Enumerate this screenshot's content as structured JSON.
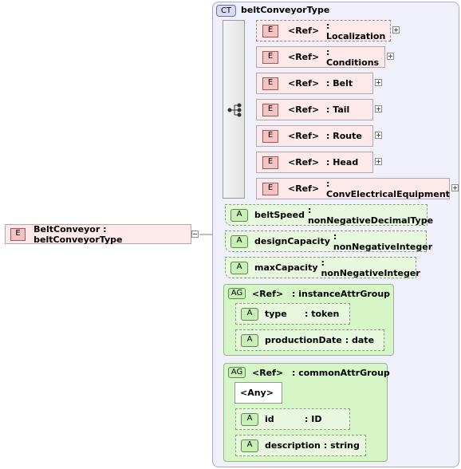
{
  "root": {
    "badge": "E",
    "label": "BeltConveyor : beltConveyorType"
  },
  "complex_type": {
    "badge": "CT",
    "name": "beltConveyorType"
  },
  "sequence": [
    {
      "badge": "E",
      "ref": "<Ref>",
      "name": ": Localization",
      "optional": true
    },
    {
      "badge": "E",
      "ref": "<Ref>",
      "name": ": Conditions",
      "optional": false
    },
    {
      "badge": "E",
      "ref": "<Ref>",
      "name": ": Belt",
      "optional": false
    },
    {
      "badge": "E",
      "ref": "<Ref>",
      "name": ": Tail",
      "optional": false
    },
    {
      "badge": "E",
      "ref": "<Ref>",
      "name": ": Route",
      "optional": false
    },
    {
      "badge": "E",
      "ref": "<Ref>",
      "name": ": Head",
      "optional": false
    },
    {
      "badge": "E",
      "ref": "<Ref>",
      "name": ": ConvElectricalEquipment",
      "optional": false
    }
  ],
  "attributes": [
    {
      "badge": "A",
      "name": "beltSpeed",
      "type": ": nonNegativeDecimalType"
    },
    {
      "badge": "A",
      "name": "designCapacity",
      "type": ": nonNegativeInteger"
    },
    {
      "badge": "A",
      "name": "maxCapacity",
      "type": ": nonNegativeInteger"
    }
  ],
  "attr_group_1": {
    "badge": "AG",
    "ref": "<Ref>",
    "name": ": instanceAttrGroup",
    "items": [
      {
        "badge": "A",
        "name": "type",
        "type": ": token"
      },
      {
        "badge": "A",
        "name": "productionDate",
        "type": ": date"
      }
    ]
  },
  "attr_group_2": {
    "badge": "AG",
    "ref": "<Ref>",
    "name": ": commonAttrGroup",
    "any": "<Any>",
    "items": [
      {
        "badge": "A",
        "name": "id",
        "type": ": ID"
      },
      {
        "badge": "A",
        "name": "description",
        "type": ": string"
      }
    ]
  }
}
